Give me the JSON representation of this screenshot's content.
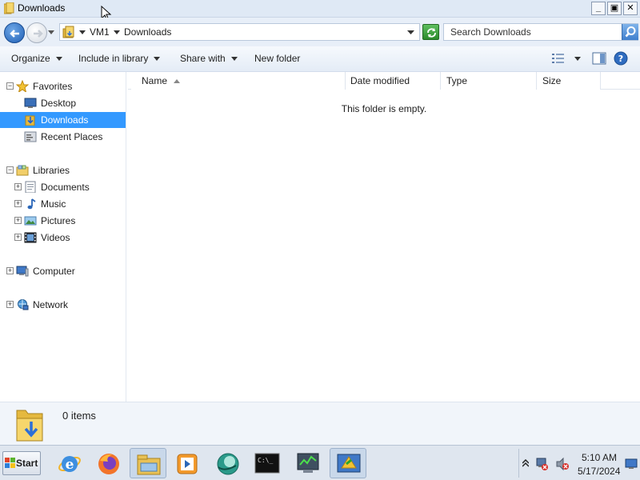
{
  "window": {
    "title": "Downloads"
  },
  "address": {
    "segments": [
      "VM1",
      "Downloads"
    ]
  },
  "search": {
    "placeholder": "Search Downloads"
  },
  "toolbar": {
    "organize": "Organize",
    "include_in_library": "Include in library",
    "share_with": "Share with",
    "new_folder": "New folder"
  },
  "nav": {
    "favorites": "Favorites",
    "desktop": "Desktop",
    "downloads": "Downloads",
    "recent_places": "Recent Places",
    "libraries": "Libraries",
    "documents": "Documents",
    "music": "Music",
    "pictures": "Pictures",
    "videos": "Videos",
    "computer": "Computer",
    "network": "Network"
  },
  "columns": [
    "Name",
    "Date modified",
    "Type",
    "Size"
  ],
  "content": {
    "empty_message": "This folder is empty."
  },
  "details": {
    "item_count": "0 items"
  },
  "taskbar": {
    "start_label": "Start",
    "time": "5:10 AM",
    "date": "5/17/2024"
  },
  "colors": {
    "selection": "#3399ff",
    "accent": "#3b7fd4"
  }
}
